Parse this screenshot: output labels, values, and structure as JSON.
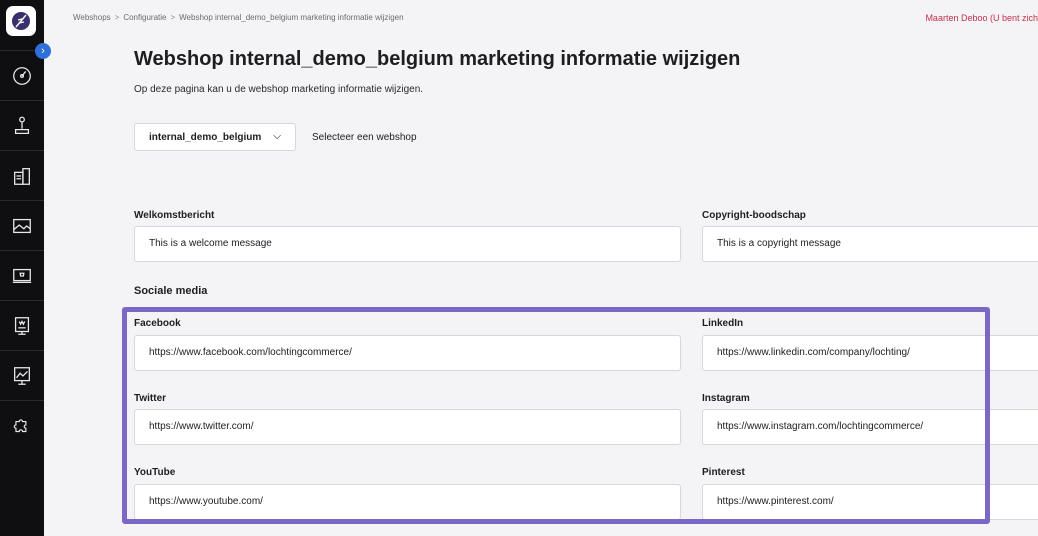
{
  "breadcrumb": {
    "items": [
      "Webshops",
      "Configuratie",
      "Webshop internal_demo_belgium marketing informatie wijzigen"
    ],
    "separator": ">"
  },
  "user": {
    "label": "Maarten Deboo (U bent zich"
  },
  "page": {
    "title": "Webshop internal_demo_belgium marketing informatie wijzigen",
    "subtitle": "Op deze pagina kan u de webshop marketing informatie wijzigen."
  },
  "webshop_select": {
    "value": "internal_demo_belgium",
    "hint": "Selecteer een webshop"
  },
  "general": {
    "welcome": {
      "label": "Welkomstbericht",
      "value": "This is a welcome message"
    },
    "copyright": {
      "label": "Copyright-boodschap",
      "value": "This is a copyright message"
    }
  },
  "social": {
    "heading": "Sociale media",
    "facebook": {
      "label": "Facebook",
      "value": "https://www.facebook.com/lochtingcommerce/"
    },
    "linkedin": {
      "label": "LinkedIn",
      "value": "https://www.linkedin.com/company/lochting/"
    },
    "twitter": {
      "label": "Twitter",
      "value": "https://www.twitter.com/"
    },
    "instagram": {
      "label": "Instagram",
      "value": "https://www.instagram.com/lochtingcommerce/"
    },
    "youtube": {
      "label": "YouTube",
      "value": "https://www.youtube.com/"
    },
    "pinterest": {
      "label": "Pinterest",
      "value": "https://www.pinterest.com/"
    }
  },
  "colors": {
    "sidebar": "#0f0f12",
    "accent_blue": "#2f6fd8",
    "highlight": "#7b68c4",
    "user_link": "#c0304a"
  },
  "sidebar_icons": [
    "feather-logo-icon",
    "dashboard-gauge-icon",
    "joystick-icon",
    "devices-icon",
    "image-icon",
    "shop-screen-icon",
    "media-screen-icon",
    "presentation-icon",
    "puzzle-icon"
  ]
}
